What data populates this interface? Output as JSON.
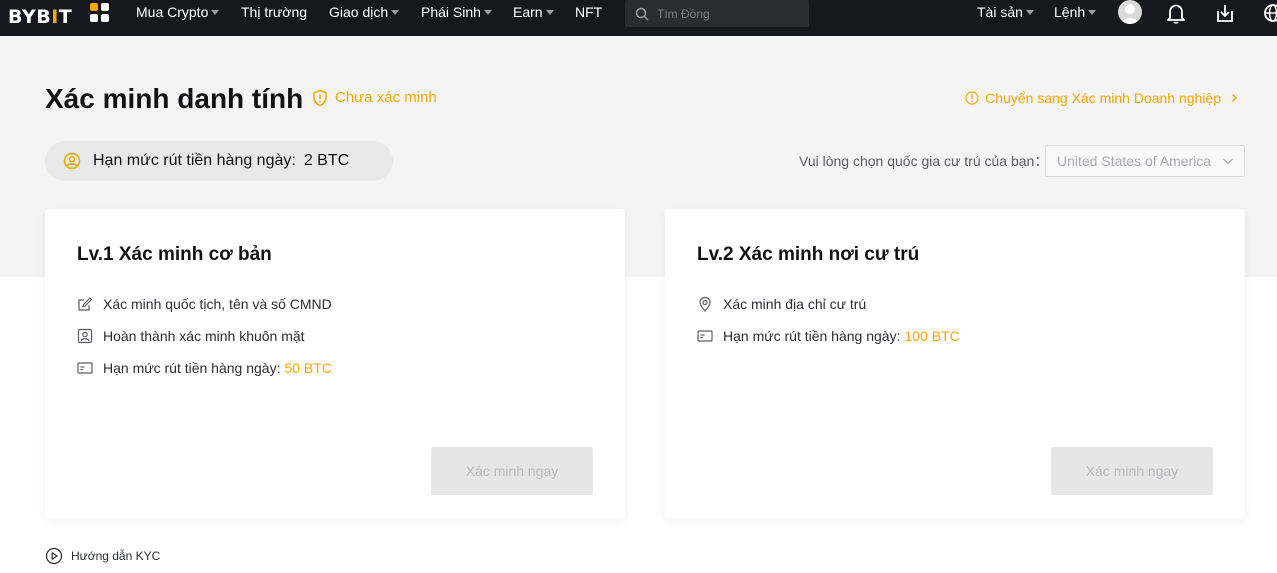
{
  "nav": {
    "logo_prefix": "BYB",
    "logo_accent": "I",
    "logo_suffix": "T",
    "items": [
      {
        "label": "Mua Crypto",
        "caret": true
      },
      {
        "label": "Thị trường",
        "caret": false
      },
      {
        "label": "Giao dịch",
        "caret": true
      },
      {
        "label": "Phái Sinh",
        "caret": true
      },
      {
        "label": "Earn",
        "caret": true
      },
      {
        "label": "NFT",
        "caret": false
      }
    ],
    "search_placeholder": "Tìm Đồng",
    "right": {
      "assets": "Tài sản",
      "orders": "Lệnh"
    },
    "icons": [
      "apps-icon",
      "search-icon",
      "user-avatar",
      "bell-icon",
      "download-icon",
      "globe-icon"
    ]
  },
  "page": {
    "title": "Xác minh danh tính",
    "status": "Chưa xác minh",
    "switch_link": "Chuyển sang Xác minh Doanh nghiệp",
    "limit_label": "Hạn mức rút tiền hàng ngày:",
    "limit_value": "2 BTC",
    "country_label": "Vui lòng chọn quốc gia cư trú của bạn：",
    "country_value": "United States of America"
  },
  "cards": [
    {
      "title": "Lv.1 Xác minh cơ bản",
      "features": [
        {
          "text": "Xác minh quốc tịch, tên và số CMND",
          "icon": "edit-icon"
        },
        {
          "text": "Hoàn thành xác minh khuôn mặt",
          "icon": "face-id-icon"
        },
        {
          "text": "Hạn mức rút tiền hàng ngày:",
          "highlight": "50 BTC",
          "icon": "card-icon"
        }
      ],
      "button": "Xác minh ngay"
    },
    {
      "title": "Lv.2 Xác minh nơi cư trú",
      "features": [
        {
          "text": "Xác minh địa chỉ cư trú",
          "icon": "location-icon"
        },
        {
          "text": "Hạn mức rút tiền hàng ngày:",
          "highlight": "100 BTC",
          "icon": "card-icon"
        }
      ],
      "button": "Xác minh ngay"
    }
  ],
  "footer": {
    "guide": "Hướng dẫn KYC"
  },
  "colors": {
    "accent": "#f7a600",
    "nav_bg": "#17181e",
    "hero_bg": "#f4f4f4"
  }
}
